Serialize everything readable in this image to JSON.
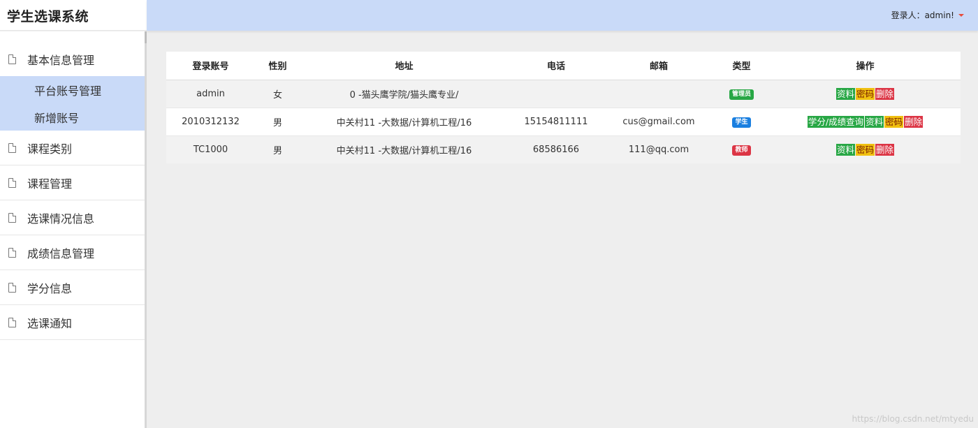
{
  "app": {
    "title": "学生选课系统"
  },
  "header": {
    "user_label": "登录人：admin!"
  },
  "sidebar": {
    "items": [
      {
        "label": "基本信息管理",
        "sub": [
          {
            "label": "平台账号管理"
          },
          {
            "label": "新增账号"
          }
        ]
      },
      {
        "label": "课程类别"
      },
      {
        "label": "课程管理"
      },
      {
        "label": "选课情况信息"
      },
      {
        "label": "成绩信息管理"
      },
      {
        "label": "学分信息"
      },
      {
        "label": "选课通知"
      }
    ]
  },
  "table": {
    "headers": [
      "登录账号",
      "性别",
      "地址",
      "电话",
      "邮箱",
      "类型",
      "操作"
    ],
    "rows": [
      {
        "account": "admin",
        "gender": "女",
        "address": "0 -猫头鹰学院/猫头鹰专业/",
        "phone": "",
        "email": "",
        "type": "管理员",
        "type_color": "#28a745",
        "actions": [
          {
            "label": "资料",
            "color": "#28a745"
          },
          {
            "label": "密码",
            "color": "#f0c010"
          },
          {
            "label": "删除",
            "color": "#dc3545"
          }
        ]
      },
      {
        "account": "2010312132",
        "gender": "男",
        "address": "中关村11 -大数据/计算机工程/16",
        "phone": "15154811111",
        "email": "cus@gmail.com",
        "type": "学生",
        "type_color": "#1a7fe0",
        "actions": [
          {
            "label": "学分/成绩查询",
            "color": "#28a745"
          },
          {
            "label": "资料",
            "color": "#28a745"
          },
          {
            "label": "密码",
            "color": "#f0c010"
          },
          {
            "label": "删除",
            "color": "#dc3545"
          }
        ]
      },
      {
        "account": "TC1000",
        "gender": "男",
        "address": "中关村11 -大数据/计算机工程/16",
        "phone": "68586166",
        "email": "111@qq.com",
        "type": "教师",
        "type_color": "#dc3545",
        "actions": [
          {
            "label": "资料",
            "color": "#28a745"
          },
          {
            "label": "密码",
            "color": "#f0c010"
          },
          {
            "label": "删除",
            "color": "#dc3545"
          }
        ]
      }
    ]
  },
  "watermark": "https://blog.csdn.net/mtyedu"
}
